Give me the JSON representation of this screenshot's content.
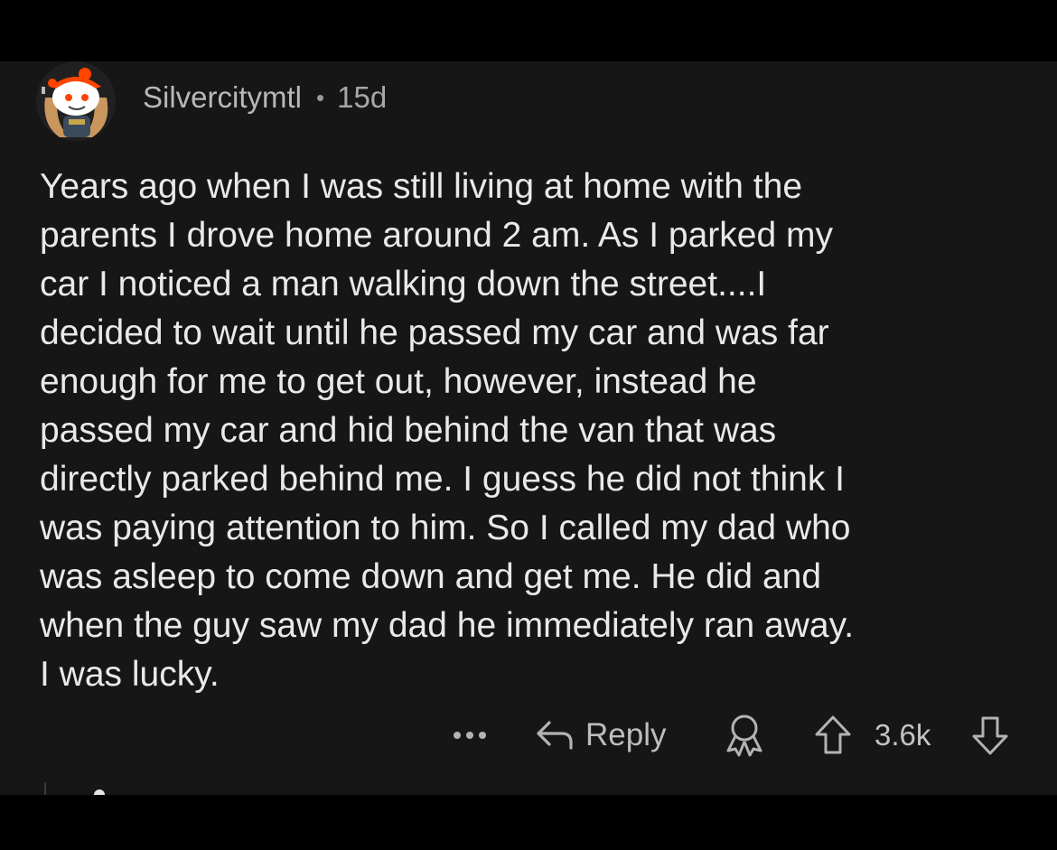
{
  "comment": {
    "username": "Silvercitymtl",
    "separator": "•",
    "age": "15d",
    "body": "Years ago when I was still living at home with the\nparents I drove home around 2 am. As I parked my\ncar I noticed a man walking down the street....I\ndecided to wait until he passed my car and was far\nenough for me to get out, however, instead he\npassed my car and hid behind the van that was\ndirectly parked behind me. I guess he did not think I\nwas paying attention to him. So I called my dad who\nwas asleep to come down and get me. He did and\nwhen the guy saw my dad he immediately ran away.\nI was lucky."
  },
  "actions": {
    "more_icon": "ellipsis-icon",
    "reply_icon": "reply-arrow-icon",
    "reply_label": "Reply",
    "award_icon": "award-icon",
    "upvote_icon": "upvote-arrow-icon",
    "score": "3.6k",
    "downvote_icon": "downvote-arrow-icon"
  },
  "colors": {
    "page_background": "#000000",
    "card_background": "#161616",
    "body_text": "#e9e9e9",
    "meta_text": "#a7a7a7",
    "icon": "#b3b3b3",
    "avatar_accent": "#ff4500"
  }
}
